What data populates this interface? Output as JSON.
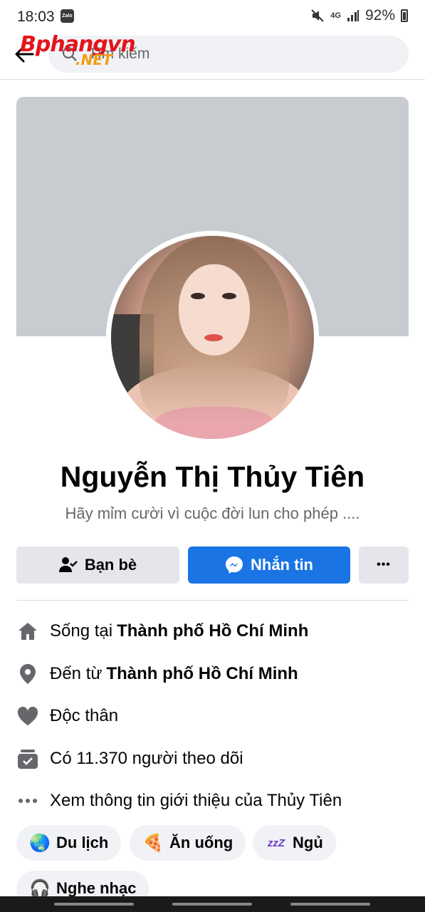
{
  "status_bar": {
    "time": "18:03",
    "zalo": "Zalo",
    "network": "4G",
    "battery": "92%"
  },
  "search": {
    "placeholder": "Tìm kiếm"
  },
  "watermark": {
    "main": "Bphangvn",
    "sub": ".NET"
  },
  "profile": {
    "name": "Nguyễn Thị Thủy Tiên",
    "bio": "Hãy mỉm cười vì cuộc đời lun cho phép ...."
  },
  "actions": {
    "friends_label": "Bạn bè",
    "message_label": "Nhắn tin",
    "more_label": "•••"
  },
  "info": {
    "lives_prefix": "Sống tại",
    "lives_city": "Thành phố Hồ Chí Minh",
    "from_prefix": "Đến từ",
    "from_city": "Thành phố Hồ Chí Minh",
    "relationship": "Độc thân",
    "followers": "Có 11.370 người theo dõi",
    "about": "Xem thông tin giới thiệu của Thủy Tiên"
  },
  "hobbies": [
    {
      "label": "Du lịch",
      "emoji": "🌏",
      "icon": "globe-icon"
    },
    {
      "label": "Ăn uống",
      "emoji": "🍕",
      "icon": "pizza-icon"
    },
    {
      "label": "Ngủ",
      "emoji": "zzZ",
      "icon": "sleep-icon"
    },
    {
      "label": "Nghe nhạc",
      "emoji": "🎧",
      "icon": "headphones-icon"
    }
  ],
  "colors": {
    "accent": "#1b74e4",
    "button_gray": "#e4e6eb",
    "cover": "#c8ccd0",
    "watermark_red": "#e3141b"
  }
}
